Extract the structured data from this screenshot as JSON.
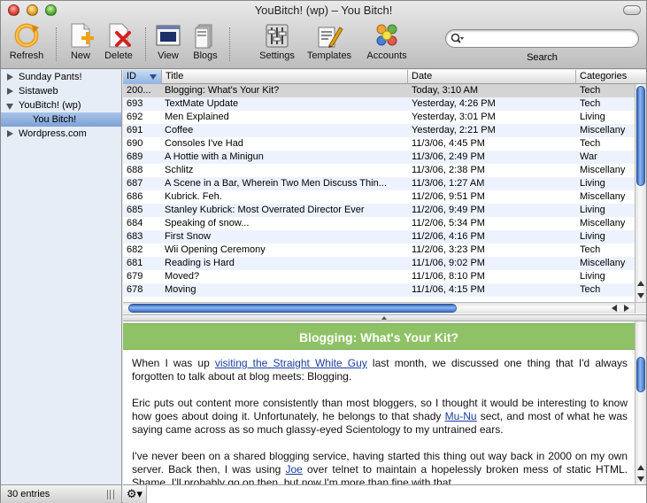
{
  "window": {
    "title": "YouBitch! (wp) – You Bitch!"
  },
  "toolbar": {
    "refresh": "Refresh",
    "new": "New",
    "delete": "Delete",
    "view": "View",
    "blogs": "Blogs",
    "settings": "Settings",
    "templates": "Templates",
    "accounts": "Accounts",
    "search_label": "Search",
    "search_value": ""
  },
  "sidebar": {
    "items": [
      {
        "label": "Sunday Pants!"
      },
      {
        "label": "Sistaweb"
      },
      {
        "label": "YouBitch! (wp)"
      },
      {
        "label": "You Bitch!"
      },
      {
        "label": "Wordpress.com"
      }
    ],
    "status": "30 entries"
  },
  "table": {
    "columns": {
      "id": "ID",
      "title": "Title",
      "date": "Date",
      "categories": "Categories"
    },
    "rows": [
      {
        "id": "200...",
        "title": "Blogging: What's Your Kit?",
        "date": "Today, 3:10 AM",
        "category": "Tech"
      },
      {
        "id": "693",
        "title": "TextMate Update",
        "date": "Yesterday, 4:26 PM",
        "category": "Tech"
      },
      {
        "id": "692",
        "title": "Men Explained",
        "date": "Yesterday, 3:01 PM",
        "category": "Living"
      },
      {
        "id": "691",
        "title": "Coffee",
        "date": "Yesterday, 2:21 PM",
        "category": "Miscellany"
      },
      {
        "id": "690",
        "title": "Consoles I've Had",
        "date": "11/3/06, 4:45 PM",
        "category": "Tech"
      },
      {
        "id": "689",
        "title": "A Hottie with a Minigun",
        "date": "11/3/06, 2:49 PM",
        "category": "War"
      },
      {
        "id": "688",
        "title": "Schlitz",
        "date": "11/3/06, 2:38 PM",
        "category": "Miscellany"
      },
      {
        "id": "687",
        "title": "A Scene in a Bar, Wherein Two Men Discuss Thin...",
        "date": "11/3/06, 1:27 AM",
        "category": "Living"
      },
      {
        "id": "686",
        "title": "Kubrick.  Feh.",
        "date": "11/2/06, 9:51 PM",
        "category": "Miscellany"
      },
      {
        "id": "685",
        "title": "Stanley Kubrick: Most Overrated Director Ever",
        "date": "11/2/06, 9:49 PM",
        "category": "Living"
      },
      {
        "id": "684",
        "title": "Speaking of snow...",
        "date": "11/2/06, 5:34 PM",
        "category": "Miscellany"
      },
      {
        "id": "683",
        "title": "First Snow",
        "date": "11/2/06, 4:16 PM",
        "category": "Living"
      },
      {
        "id": "682",
        "title": "Wii Opening Ceremony",
        "date": "11/2/06, 3:23 PM",
        "category": "Tech"
      },
      {
        "id": "681",
        "title": "Reading is Hard",
        "date": "11/1/06, 9:02 PM",
        "category": "Miscellany"
      },
      {
        "id": "679",
        "title": "Moved?",
        "date": "11/1/06, 8:10 PM",
        "category": "Living"
      },
      {
        "id": "678",
        "title": "Moving",
        "date": "11/1/06, 4:15 PM",
        "category": "Tech"
      }
    ]
  },
  "preview": {
    "title": "Blogging: What's Your Kit?",
    "p1_a": "When I was up ",
    "p1_link": "visiting the Straight White Guy",
    "p1_b": " last month, we discussed one thing that I'd always forgotten to talk about at blog meets: Blogging.",
    "p2_a": "Eric puts out content more consistently than most bloggers, so I thought it would be interesting to know how goes about doing it. Unfortunately, he belongs to that shady ",
    "p2_link": "Mu-Nu",
    "p2_b": " sect, and most of what he was saying came across as so much glassy-eyed Scientology to my untrained ears.",
    "p3_a": "I've never been on a shared blogging service, having started this thing out way back in 2000 on my own server. Back then, I was using ",
    "p3_link": "Joe",
    "p3_b": " over telnet to maintain a hopelessly broken mess of static HTML. Shame. I'll probably go on then, but now I'm more than fine with that."
  }
}
